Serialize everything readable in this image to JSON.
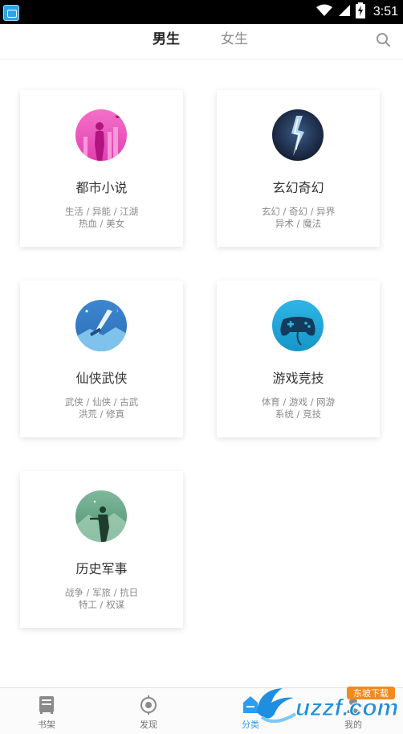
{
  "status_bar": {
    "time": "3:51"
  },
  "header": {
    "tabs": [
      {
        "label": "男生",
        "active": true
      },
      {
        "label": "女生",
        "active": false
      }
    ]
  },
  "categories": [
    {
      "title": "都市小说",
      "tags_line1": "生活 / 异能 / 江湖",
      "tags_line2": "热血 / 美女",
      "icon": "city-woman-icon"
    },
    {
      "title": "玄幻奇幻",
      "tags_line1": "玄幻 / 奇幻 / 异界",
      "tags_line2": "异术 / 魔法",
      "icon": "lightning-icon"
    },
    {
      "title": "仙侠武侠",
      "tags_line1": "武侠 / 仙侠 / 古武",
      "tags_line2": "洪荒 / 修真",
      "icon": "sword-icon"
    },
    {
      "title": "游戏竞技",
      "tags_line1": "体育 / 游戏 / 网游",
      "tags_line2": "系统 / 竞技",
      "icon": "gamepad-icon"
    },
    {
      "title": "历史军事",
      "tags_line1": "战争 / 军旅 / 抗日",
      "tags_line2": "特工 / 权谋",
      "icon": "soldier-icon"
    }
  ],
  "bottom_nav": [
    {
      "label": "书架",
      "icon": "bookshelf-icon",
      "active": false
    },
    {
      "label": "发现",
      "icon": "discover-icon",
      "active": false
    },
    {
      "label": "分类",
      "icon": "category-icon",
      "active": true
    },
    {
      "label": "我的",
      "icon": "profile-icon",
      "active": false
    }
  ],
  "watermark": {
    "text": "uzzf.com",
    "badge": "东坡下载"
  },
  "colors": {
    "accent": "#2b9cf3",
    "text": "#333333",
    "muted": "#8a8a8a"
  }
}
